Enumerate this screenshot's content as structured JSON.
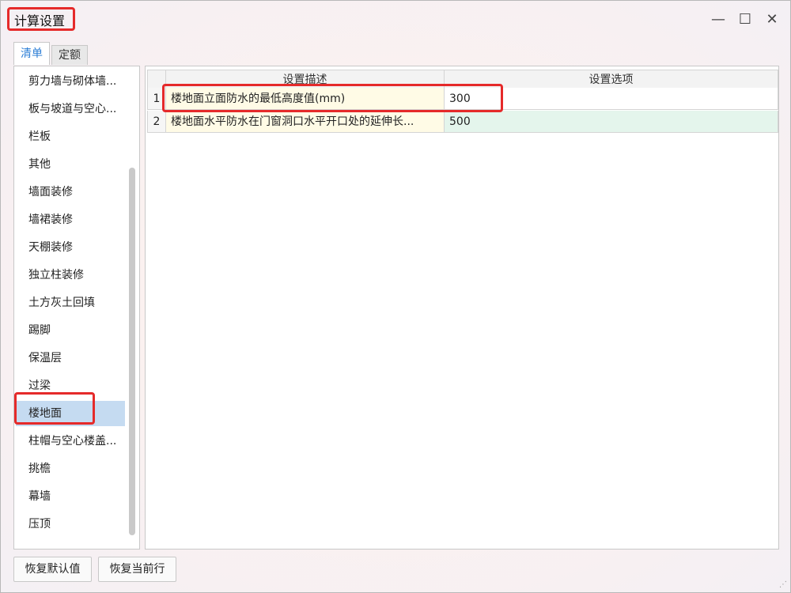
{
  "window": {
    "title": "计算设置",
    "minimize": "—",
    "maximize": "☐",
    "close": "✕"
  },
  "tabs": [
    {
      "label": "清单",
      "active": true
    },
    {
      "label": "定额",
      "active": false
    }
  ],
  "left_list": {
    "items": [
      "剪力墙与砌体墙...",
      "板与坡道与空心...",
      "栏板",
      "其他",
      "墙面装修",
      "墙裙装修",
      "天棚装修",
      "独立柱装修",
      "土方灰土回填",
      "踢脚",
      "保温层",
      "过梁",
      "楼地面",
      "柱帽与空心楼盖...",
      "挑檐",
      "幕墙",
      "压顶"
    ],
    "selected": "楼地面"
  },
  "grid": {
    "headers": [
      "",
      "设置描述",
      "设置选项"
    ],
    "rows": [
      {
        "num": "1",
        "desc": "楼地面立面防水的最低高度值(mm)",
        "value": "300"
      },
      {
        "num": "2",
        "desc": "楼地面水平防水在门窗洞口水平开口处的延伸长...",
        "value": "500"
      }
    ]
  },
  "buttons": {
    "restore_default": "恢复默认值",
    "restore_row": "恢复当前行"
  },
  "colors": {
    "highlight": "#e52a2a",
    "tab_active_text": "#2e7fd6",
    "selected_item": "#c5dbf1",
    "desc_cell": "#fffbe6",
    "row2_value": "#e4f5ec"
  }
}
